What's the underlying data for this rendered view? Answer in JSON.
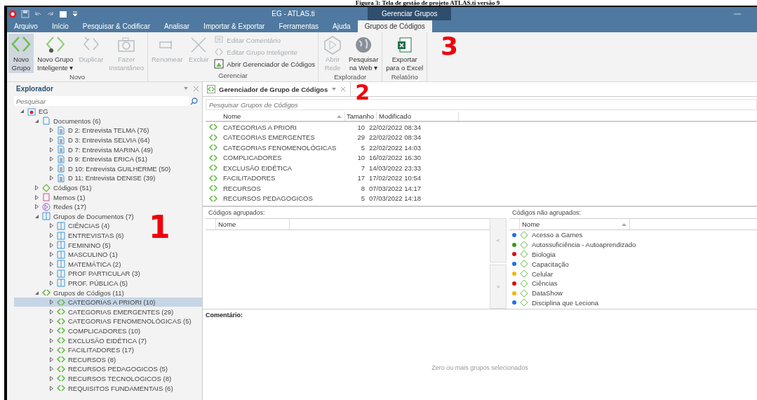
{
  "caption": "Figura 3: Tela de gestão de projeto ATLAS.ti versão 9",
  "window": {
    "title": "EG - ATLAS.ti",
    "context_tab": "Gerenciar Grupos"
  },
  "menu_tabs": [
    {
      "label": "Arquivo",
      "selected": false
    },
    {
      "label": "Início",
      "selected": false
    },
    {
      "label": "Pesquisar & Codificar",
      "selected": false
    },
    {
      "label": "Analisar",
      "selected": false
    },
    {
      "label": "Importar & Exportar",
      "selected": false
    },
    {
      "label": "Ferramentas",
      "selected": false
    },
    {
      "label": "Ajuda",
      "selected": false
    },
    {
      "label": "Grupos de Códigos",
      "selected": true
    }
  ],
  "ribbon": [
    {
      "label": "Novo",
      "items": [
        {
          "kind": "big",
          "lines": [
            "Novo",
            "Grupo"
          ],
          "disabled": false,
          "selected": true
        },
        {
          "kind": "big",
          "lines": [
            "Novo Grupo",
            "Inteligente ▾"
          ],
          "disabled": false,
          "selected": false
        },
        {
          "kind": "big",
          "lines": [
            "Duplicar"
          ],
          "disabled": true,
          "selected": false
        },
        {
          "kind": "big",
          "lines": [
            "Fazer",
            "Instantâneo"
          ],
          "disabled": true,
          "selected": false
        }
      ]
    },
    {
      "label": "Gerenciar",
      "items": [
        {
          "kind": "big",
          "lines": [
            "Renomear"
          ],
          "disabled": true,
          "selected": false
        },
        {
          "kind": "big",
          "lines": [
            "Excluir"
          ],
          "disabled": true,
          "selected": false
        },
        {
          "kind": "stack",
          "rows": [
            {
              "label": "Editar Comentário",
              "disabled": true
            },
            {
              "label": "Editar Grupo Inteligente",
              "disabled": true
            },
            {
              "label": "Abrir Gerenciador de Códigos",
              "disabled": false
            }
          ]
        }
      ]
    },
    {
      "label": "Explorador",
      "items": [
        {
          "kind": "big",
          "lines": [
            "Abrir",
            "Rede"
          ],
          "disabled": true,
          "selected": false
        },
        {
          "kind": "big",
          "lines": [
            "Pesquisar",
            "na Web ▾"
          ],
          "disabled": false,
          "selected": false
        }
      ]
    },
    {
      "label": "Relatório",
      "items": [
        {
          "kind": "big",
          "lines": [
            "Exportar",
            "para o Excel"
          ],
          "disabled": false,
          "selected": false
        }
      ]
    }
  ],
  "annotations": [
    "1",
    "2",
    "3"
  ],
  "explorer": {
    "title": "Explorador",
    "search": {
      "placeholder": "Pesquisar"
    },
    "tree": [
      {
        "label": "EG",
        "kind": "project",
        "expanded": true,
        "selected": false,
        "children": [
          {
            "label": "Documentos (6)",
            "kind": "documents",
            "expanded": true,
            "selected": false,
            "children": [
              {
                "label": "D 2: Entrevista TELMA (76)",
                "kind": "document",
                "expanded": false,
                "selected": false
              },
              {
                "label": "D 3: Entrevista SELVIA (64)",
                "kind": "document",
                "expanded": false,
                "selected": false
              },
              {
                "label": "D 7: Entrevista MARINA (49)",
                "kind": "document",
                "expanded": false,
                "selected": false
              },
              {
                "label": "D 9: Entrevista ERICA (51)",
                "kind": "document",
                "expanded": false,
                "selected": false
              },
              {
                "label": "D 10: Entrevista GUILHERME (50)",
                "kind": "document",
                "expanded": false,
                "selected": false
              },
              {
                "label": "D 11: Entrevista DENISE (39)",
                "kind": "document",
                "expanded": false,
                "selected": false
              }
            ]
          },
          {
            "label": "Códigos (51)",
            "kind": "codes",
            "expanded": false,
            "selected": false
          },
          {
            "label": "Memos (1)",
            "kind": "memos",
            "expanded": false,
            "selected": false
          },
          {
            "label": "Redes (17)",
            "kind": "networks",
            "expanded": false,
            "selected": false
          },
          {
            "label": "Grupos de Documentos (7)",
            "kind": "docgroups",
            "expanded": true,
            "selected": false,
            "children": [
              {
                "label": "CIÊNCIAS (4)",
                "kind": "docgroup",
                "expanded": false,
                "selected": false
              },
              {
                "label": "ENTREVISTAS (6)",
                "kind": "docgroup",
                "expanded": false,
                "selected": false
              },
              {
                "label": "FEMININO (5)",
                "kind": "docgroup",
                "expanded": false,
                "selected": false
              },
              {
                "label": "MASCULINO (1)",
                "kind": "docgroup",
                "expanded": false,
                "selected": false
              },
              {
                "label": "MATEMÁTICA (2)",
                "kind": "docgroup",
                "expanded": false,
                "selected": false
              },
              {
                "label": "PROF PARTICULAR (3)",
                "kind": "docgroup",
                "expanded": false,
                "selected": false
              },
              {
                "label": "PROF. PÚBLICA (5)",
                "kind": "docgroup",
                "expanded": false,
                "selected": false
              }
            ]
          },
          {
            "label": "Grupos de Códigos (11)",
            "kind": "codegroups",
            "expanded": true,
            "selected": false,
            "children": [
              {
                "label": "CATEGORIAS A PRIORI (10)",
                "kind": "codegroup",
                "expanded": false,
                "selected": true
              },
              {
                "label": "CATEGORIAS EMERGENTES (29)",
                "kind": "codegroup",
                "expanded": false,
                "selected": false
              },
              {
                "label": "CATEGORIAS FENOMENOLÓGICAS (5)",
                "kind": "codegroup",
                "expanded": false,
                "selected": false
              },
              {
                "label": "COMPLICADORES (10)",
                "kind": "codegroup",
                "expanded": false,
                "selected": false
              },
              {
                "label": "EXCLUSÃO EIDÉTICA (7)",
                "kind": "codegroup",
                "expanded": false,
                "selected": false
              },
              {
                "label": "FACILITADORES (17)",
                "kind": "codegroup",
                "expanded": false,
                "selected": false
              },
              {
                "label": "RECURSOS (8)",
                "kind": "codegroup",
                "expanded": false,
                "selected": false
              },
              {
                "label": "RECURSOS PEDAGOGICOS (5)",
                "kind": "codegroup",
                "expanded": false,
                "selected": false
              },
              {
                "label": "RECURSOS TECNOLOGICOS (8)",
                "kind": "codegroup",
                "expanded": false,
                "selected": false
              },
              {
                "label": "REQUISITOS FUNDAMENTAIS (6)",
                "kind": "codegroup",
                "expanded": false,
                "selected": false
              }
            ]
          }
        ]
      }
    ]
  },
  "manager": {
    "tab": "Gerenciador de Grupo de Códigos",
    "search": {
      "placeholder": "Pesquisar Grupos de Códigos"
    },
    "columns": [
      "Nome",
      "Tamanho",
      "Modificado"
    ],
    "rows": [
      {
        "name": "CATEGORIAS A PRIORI",
        "size": "10",
        "modified": "22/02/2022 08:34"
      },
      {
        "name": "CATEGORIAS EMERGENTES",
        "size": "29",
        "modified": "22/02/2022 08:34"
      },
      {
        "name": "CATEGORIAS FENOMENOLÓGICAS",
        "size": "5",
        "modified": "22/02/2022 14:03"
      },
      {
        "name": "COMPLICADORES",
        "size": "10",
        "modified": "16/02/2022 16:30"
      },
      {
        "name": "EXCLUSÃO EIDÉTICA",
        "size": "7",
        "modified": "14/03/2022 23:33"
      },
      {
        "name": "FACILITADORES",
        "size": "17",
        "modified": "17/02/2022 10:54"
      },
      {
        "name": "RECURSOS",
        "size": "8",
        "modified": "07/03/2022 14:17"
      },
      {
        "name": "RECURSOS PEDAGOGICOS",
        "size": "5",
        "modified": "07/03/2022 14:18"
      }
    ],
    "grouped": {
      "title": "Códigos agrupados:",
      "column": "Nome"
    },
    "move_buttons": [
      "<",
      ">"
    ],
    "ungrouped": {
      "title": "Códigos não agrupados:",
      "column": "Nome",
      "codes": [
        {
          "name": "Acesso a Games",
          "color": "#1a73e8"
        },
        {
          "name": "Autossuficiência - Autoaprendizado",
          "color": "#3a9a17"
        },
        {
          "name": "Biologia",
          "color": "#d80f0f"
        },
        {
          "name": "Capacitação",
          "color": "#1a73e8"
        },
        {
          "name": "Celular",
          "color": "#f5b400"
        },
        {
          "name": "Ciências",
          "color": "#d80f0f"
        },
        {
          "name": "DataShow",
          "color": "#f5b400"
        },
        {
          "name": "Disciplina que Leciona",
          "color": "#1a73e8"
        }
      ]
    },
    "comment": {
      "label": "Comentário:",
      "empty_text": "Zero ou mais grupos selecionados"
    }
  }
}
